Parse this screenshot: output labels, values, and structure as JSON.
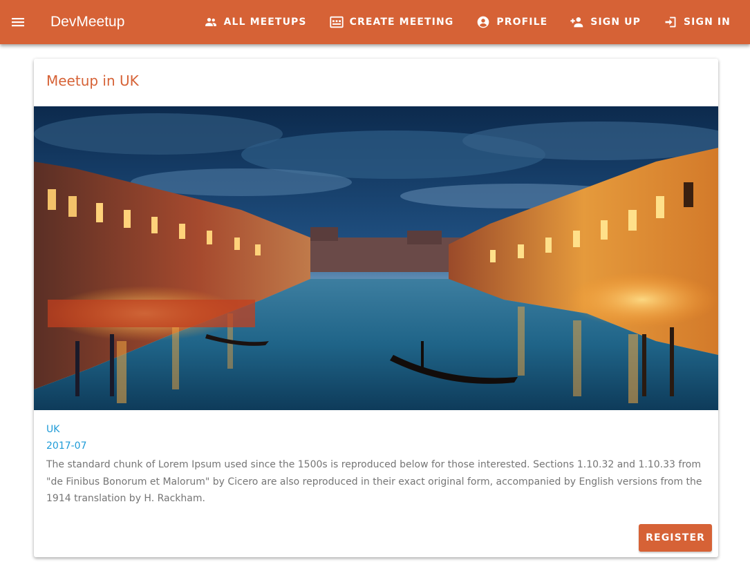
{
  "app": {
    "title": "DevMeetup"
  },
  "nav": {
    "items": [
      {
        "label": "ALL MEETUPS",
        "icon": "group-icon"
      },
      {
        "label": "CREATE MEETING",
        "icon": "room-icon"
      },
      {
        "label": "PROFILE",
        "icon": "account-circle-icon"
      },
      {
        "label": "SIGN UP",
        "icon": "person-add-icon"
      },
      {
        "label": "SIGN IN",
        "icon": "login-icon"
      }
    ]
  },
  "meetup": {
    "title": "Meetup in UK",
    "image": "venice-grand-canal-at-dusk",
    "location": "UK",
    "date": "2017-07",
    "description": "The standard chunk of Lorem Ipsum used since the 1500s is reproduced below for those interested. Sections 1.10.32 and 1.10.33 from \"de Finibus Bonorum et Malorum\" by Cicero are also reproduced in their exact original form, accompanied by English versions from the 1914 translation by H. Rackham.",
    "register_label": "REGISTER"
  },
  "colors": {
    "primary": "#d66236",
    "accent": "#1e9bd7",
    "text_secondary": "#757575"
  }
}
